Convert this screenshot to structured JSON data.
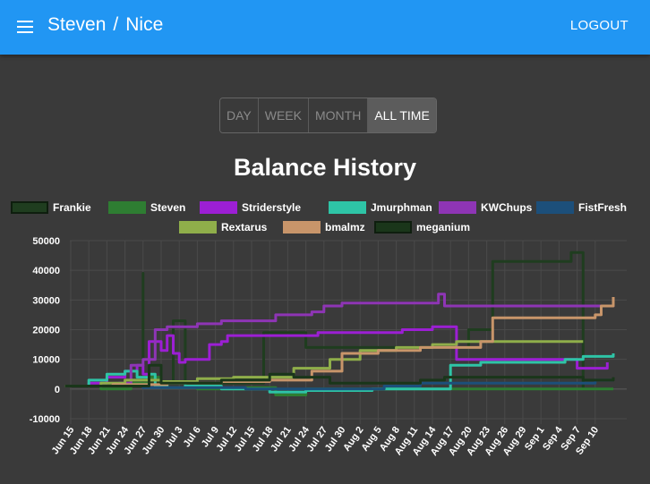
{
  "appbar": {
    "user": "Steven",
    "separator": "/",
    "group": "Nice",
    "logout_label": "LOGOUT",
    "menu_icon": "hamburger-menu-icon",
    "color": "#2196f3"
  },
  "range_selector": {
    "options": [
      "DAY",
      "WEEK",
      "MONTH",
      "ALL TIME"
    ],
    "selected": "ALL TIME"
  },
  "chart_data": {
    "type": "line",
    "title": "Balance History",
    "legend_position": "top",
    "grid": true,
    "ylim": [
      -10000,
      50000
    ],
    "y_ticks": [
      "50000",
      "40000",
      "30000",
      "20000",
      "10000",
      "0",
      "-10000"
    ],
    "x_ticks": [
      "Jun 15",
      "Jun 18",
      "Jun 21",
      "Jun 24",
      "Jun 27",
      "Jun 30",
      "Jul 3",
      "Jul 6",
      "Jul 9",
      "Jul 12",
      "Jul 15",
      "Jul 18",
      "Jul 21",
      "Jul 24",
      "Jul 27",
      "Jul 30",
      "Aug 2",
      "Aug 5",
      "Aug 8",
      "Aug 11",
      "Aug 14",
      "Aug 17",
      "Aug 20",
      "Aug 23",
      "Aug 26",
      "Aug 29",
      "Sep 1",
      "Sep 4",
      "Sep 7",
      "Sep 10"
    ],
    "series": [
      {
        "name": "Frankie",
        "color": "#1f3d1f",
        "points": [
          [
            "06-14",
            1000
          ],
          [
            "06-22",
            1000
          ],
          [
            "06-27",
            39000
          ],
          [
            "06-27",
            2000
          ],
          [
            "07-02",
            23000
          ],
          [
            "07-04",
            22000
          ],
          [
            "07-04",
            2000
          ],
          [
            "07-16",
            2000
          ],
          [
            "07-17",
            19000
          ],
          [
            "07-23",
            19000
          ],
          [
            "07-24",
            14000
          ],
          [
            "07-27",
            14000
          ],
          [
            "08-10",
            14000
          ],
          [
            "08-20",
            14000
          ],
          [
            "08-20",
            20000
          ],
          [
            "08-24",
            20000
          ],
          [
            "08-24",
            43000
          ],
          [
            "09-05",
            43000
          ],
          [
            "09-06",
            46000
          ],
          [
            "09-08",
            46000
          ],
          [
            "09-08",
            0
          ],
          [
            "09-13",
            0
          ]
        ]
      },
      {
        "name": "Steven",
        "color": "#2e7d32",
        "points": [
          [
            "06-14",
            1000
          ],
          [
            "06-20",
            0
          ],
          [
            "06-25",
            2000
          ],
          [
            "06-28",
            4000
          ],
          [
            "06-30",
            500
          ],
          [
            "07-06",
            0
          ],
          [
            "07-14",
            500
          ],
          [
            "07-19",
            -2000
          ],
          [
            "07-24",
            0
          ],
          [
            "08-04",
            0
          ],
          [
            "08-14",
            0
          ],
          [
            "08-20",
            0
          ],
          [
            "09-01",
            0
          ],
          [
            "09-13",
            0
          ]
        ]
      },
      {
        "name": "Striderstyle",
        "color": "#9c1fd4",
        "points": [
          [
            "06-14",
            1000
          ],
          [
            "06-18",
            2000
          ],
          [
            "06-21",
            4000
          ],
          [
            "06-24",
            6000
          ],
          [
            "06-26",
            8000
          ],
          [
            "06-27",
            5000
          ],
          [
            "06-28",
            16000
          ],
          [
            "06-30",
            13000
          ],
          [
            "07-01",
            18000
          ],
          [
            "07-02",
            12000
          ],
          [
            "07-03",
            9000
          ],
          [
            "07-04",
            10000
          ],
          [
            "07-07",
            10000
          ],
          [
            "07-08",
            15000
          ],
          [
            "07-10",
            16000
          ],
          [
            "07-11",
            18000
          ],
          [
            "07-15",
            18000
          ],
          [
            "07-18",
            18000
          ],
          [
            "07-26",
            19000
          ],
          [
            "08-02",
            19000
          ],
          [
            "08-09",
            20000
          ],
          [
            "08-14",
            21000
          ],
          [
            "08-17",
            21000
          ],
          [
            "08-18",
            10000
          ],
          [
            "08-22",
            10000
          ],
          [
            "09-05",
            10000
          ],
          [
            "09-07",
            7000
          ],
          [
            "09-12",
            9000
          ]
        ]
      },
      {
        "name": "Jmurphman",
        "color": "#2ec4a6",
        "points": [
          [
            "06-14",
            1000
          ],
          [
            "06-18",
            3000
          ],
          [
            "06-21",
            5000
          ],
          [
            "06-24",
            6000
          ],
          [
            "06-26",
            4000
          ],
          [
            "06-28",
            5000
          ],
          [
            "06-29",
            1000
          ],
          [
            "07-01",
            2000
          ],
          [
            "07-04",
            1000
          ],
          [
            "07-10",
            0
          ],
          [
            "07-18",
            -1000
          ],
          [
            "07-24",
            -500
          ],
          [
            "08-04",
            0
          ],
          [
            "08-10",
            0
          ],
          [
            "08-14",
            0
          ],
          [
            "08-17",
            0
          ],
          [
            "08-17",
            8000
          ],
          [
            "08-21",
            8000
          ],
          [
            "08-22",
            9000
          ],
          [
            "09-01",
            9000
          ],
          [
            "09-05",
            10000
          ],
          [
            "09-08",
            11000
          ],
          [
            "09-13",
            12000
          ]
        ]
      },
      {
        "name": "KWChups",
        "color": "#8e35b5",
        "points": [
          [
            "06-14",
            1000
          ],
          [
            "06-23",
            2000
          ],
          [
            "06-25",
            8000
          ],
          [
            "06-27",
            10000
          ],
          [
            "06-29",
            20000
          ],
          [
            "07-01",
            21000
          ],
          [
            "07-06",
            22000
          ],
          [
            "07-10",
            23000
          ],
          [
            "07-14",
            23000
          ],
          [
            "07-17",
            23000
          ],
          [
            "07-19",
            25000
          ],
          [
            "07-25",
            26000
          ],
          [
            "07-27",
            28000
          ],
          [
            "07-30",
            29000
          ],
          [
            "08-14",
            29000
          ],
          [
            "08-15",
            32000
          ],
          [
            "08-16",
            28000
          ],
          [
            "08-22",
            28000
          ],
          [
            "09-13",
            30000
          ]
        ]
      },
      {
        "name": "FistFresh",
        "color": "#1c4f7a",
        "points": [
          [
            "06-14",
            1000
          ],
          [
            "06-20",
            1000
          ],
          [
            "06-27",
            500
          ],
          [
            "07-04",
            500
          ],
          [
            "07-14",
            0
          ],
          [
            "07-24",
            0
          ],
          [
            "08-06",
            1000
          ],
          [
            "08-12",
            2000
          ],
          [
            "08-19",
            2000
          ],
          [
            "09-01",
            2000
          ],
          [
            "09-10",
            3000
          ],
          [
            "09-13",
            3000
          ]
        ]
      },
      {
        "name": "Rextarus",
        "color": "#8fae4a",
        "points": [
          [
            "06-14",
            1000
          ],
          [
            "06-20",
            2000
          ],
          [
            "06-24",
            3000
          ],
          [
            "06-30",
            2500
          ],
          [
            "07-06",
            3500
          ],
          [
            "07-12",
            4000
          ],
          [
            "07-18",
            4000
          ],
          [
            "07-22",
            7000
          ],
          [
            "07-28",
            10000
          ],
          [
            "08-02",
            13000
          ],
          [
            "08-08",
            14000
          ],
          [
            "08-14",
            15000
          ],
          [
            "08-17",
            15000
          ],
          [
            "08-18",
            16000
          ],
          [
            "09-08",
            16000
          ]
        ]
      },
      {
        "name": "bmalmz",
        "color": "#c8956a",
        "points": [
          [
            "06-14",
            1000
          ],
          [
            "06-22",
            1500
          ],
          [
            "07-01",
            2000
          ],
          [
            "07-10",
            2500
          ],
          [
            "07-18",
            3000
          ],
          [
            "07-25",
            6000
          ],
          [
            "07-30",
            12000
          ],
          [
            "08-05",
            13000
          ],
          [
            "08-12",
            14000
          ],
          [
            "08-17",
            14000
          ],
          [
            "08-22",
            16000
          ],
          [
            "08-24",
            24000
          ],
          [
            "09-01",
            24000
          ],
          [
            "09-08",
            24000
          ],
          [
            "09-10",
            25000
          ],
          [
            "09-11",
            28000
          ],
          [
            "09-13",
            31000
          ]
        ]
      },
      {
        "name": "meganium",
        "color": "#1a361a",
        "points": [
          [
            "06-14",
            1000
          ],
          [
            "06-22",
            1000
          ],
          [
            "06-28",
            8000
          ],
          [
            "06-30",
            2000
          ],
          [
            "07-06",
            2000
          ],
          [
            "07-10",
            3000
          ],
          [
            "07-18",
            5000
          ],
          [
            "07-22",
            4000
          ],
          [
            "07-28",
            2000
          ],
          [
            "08-06",
            2000
          ],
          [
            "08-12",
            3000
          ],
          [
            "08-16",
            4000
          ],
          [
            "08-22",
            4000
          ],
          [
            "09-01",
            4000
          ],
          [
            "09-08",
            3000
          ],
          [
            "09-13",
            4000
          ]
        ]
      }
    ]
  }
}
